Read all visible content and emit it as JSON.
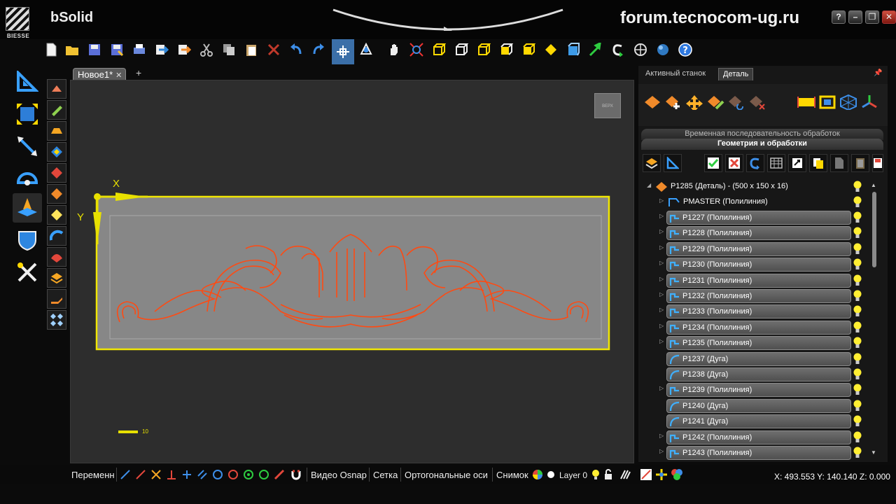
{
  "app": {
    "logo_brand": "BIESSE",
    "name": "bSolid",
    "watermark": "forum.tecnocom-ug.ru"
  },
  "window_buttons": [
    "?",
    "–",
    "❐",
    "✕"
  ],
  "toolbar": {
    "icons": [
      "new-file-icon",
      "open-folder-icon",
      "save-icon",
      "save-as-icon",
      "print-icon",
      "import-icon",
      "export-icon",
      "cut-icon",
      "copy-icon",
      "paste-icon",
      "delete-icon",
      "undo-icon",
      "redo-icon",
      "snap-point-icon",
      "orbit-icon",
      "pan-hand-icon",
      "zoom-extents-icon",
      "view-cube-1-icon",
      "view-cube-2-icon",
      "view-cube-3-icon",
      "view-cube-4-icon",
      "view-cube-5-icon",
      "view-iso-icon",
      "box-icon",
      "pointer-icon",
      "refresh-icon",
      "globe-grid-icon",
      "sphere-icon",
      "help-icon"
    ]
  },
  "document": {
    "tab_label": "Новое1*",
    "close": "✕",
    "add": "+"
  },
  "viewport": {
    "view_cube_label": "ВЕРХ",
    "axis_x": "X",
    "axis_y": "Y",
    "scale_label": "10",
    "part_color": "#e8e000",
    "ornament_color": "#ff4a12"
  },
  "status_bar": {
    "variables": "Переменн",
    "video_osnap": "Видео Osnap",
    "grid": "Сетка",
    "ortho": "Ортогональные оси",
    "snapshot": "Снимок",
    "layer": "Layer 0",
    "coords": "X: 493.553  Y: 140.140  Z: 0.000"
  },
  "right_panel": {
    "tabs": [
      "Активный станок",
      "Деталь"
    ],
    "selected_tab": 1,
    "sequence_header": "Временная последовательность обработок",
    "geometry_header": "Геометрия и обработки",
    "root_item": "P1285 (Деталь) - (500 x 150 x 16)",
    "master_item": "PMASTER (Полилиния)",
    "items": [
      {
        "label": "P1227 (Полилиния)",
        "type": "polyline",
        "expandable": true
      },
      {
        "label": "P1228 (Полилиния)",
        "type": "polyline",
        "expandable": true
      },
      {
        "label": "P1229 (Полилиния)",
        "type": "polyline",
        "expandable": true
      },
      {
        "label": "P1230 (Полилиния)",
        "type": "polyline",
        "expandable": true
      },
      {
        "label": "P1231 (Полилиния)",
        "type": "polyline",
        "expandable": true
      },
      {
        "label": "P1232 (Полилиния)",
        "type": "polyline",
        "expandable": true
      },
      {
        "label": "P1233 (Полилиния)",
        "type": "polyline",
        "expandable": true
      },
      {
        "label": "P1234 (Полилиния)",
        "type": "polyline",
        "expandable": true
      },
      {
        "label": "P1235 (Полилиния)",
        "type": "polyline",
        "expandable": true
      },
      {
        "label": "P1237 (Дуга)",
        "type": "arc",
        "expandable": false
      },
      {
        "label": "P1238 (Дуга)",
        "type": "arc",
        "expandable": false
      },
      {
        "label": "P1239 (Полилиния)",
        "type": "polyline",
        "expandable": true
      },
      {
        "label": "P1240 (Дуга)",
        "type": "arc",
        "expandable": false
      },
      {
        "label": "P1241 (Дуга)",
        "type": "arc",
        "expandable": false
      },
      {
        "label": "P1242 (Полилиния)",
        "type": "polyline",
        "expandable": true
      },
      {
        "label": "P1243 (Полилиния)",
        "type": "polyline",
        "expandable": true
      }
    ]
  }
}
